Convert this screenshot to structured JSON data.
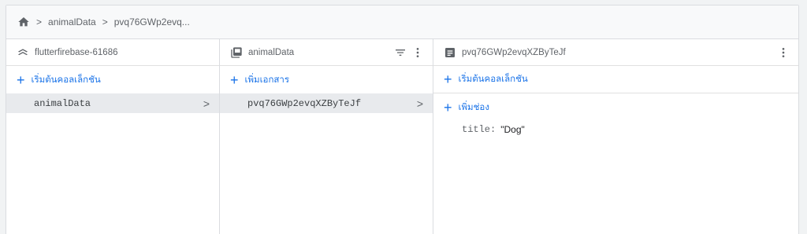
{
  "breadcrumb": {
    "home_icon": "home-icon",
    "items": [
      "animalData",
      "pvq76GWp2evq..."
    ],
    "separator": ">"
  },
  "columns": {
    "project": {
      "title": "flutterfirebase-61686",
      "icon": "firestore-project-icon",
      "action_label": "เริ่มต้นคอลเล็กชัน",
      "items": [
        {
          "label": "animalData",
          "chevron": ">"
        }
      ]
    },
    "collection": {
      "title": "animalData",
      "icon": "collection-icon",
      "filter_icon": "filter-icon",
      "menu_icon": "more-vert-icon",
      "action_label": "เพิ่มเอกสาร",
      "items": [
        {
          "label": "pvq76GWp2evqXZByTeJf",
          "chevron": ">"
        }
      ]
    },
    "document": {
      "title": "pvq76GWp2evqXZByTeJf",
      "icon": "document-icon",
      "menu_icon": "more-vert-icon",
      "start_collection_label": "เริ่มต้นคอลเล็กชัน",
      "add_field_label": "เพิ่มช่อง",
      "fields": [
        {
          "key": "title",
          "sep": ":",
          "value": "\"Dog\""
        }
      ]
    }
  },
  "colors": {
    "accent": "#1a73e8",
    "selected_bg": "#e8eaed",
    "border": "#dadce0"
  }
}
